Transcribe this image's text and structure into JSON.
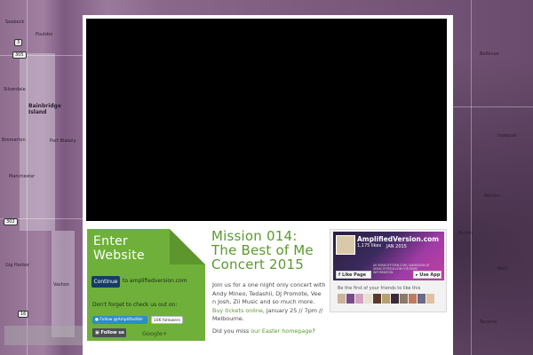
{
  "map": {
    "labels": [
      "Seabeck",
      "Poulsbo",
      "Silverdale",
      "Bremerton",
      "Bainbridge Island",
      "Port Blakely",
      "Manchester",
      "Gig Harbor",
      "Vashon",
      "Burien",
      "Tacoma",
      "Kent",
      "Bellevue",
      "Issaquah",
      "Renton"
    ],
    "shields": [
      "305",
      "16",
      "302",
      "3"
    ]
  },
  "enter_panel": {
    "heading": "Enter Website",
    "continue_label": "Continue",
    "continue_suffix": "to amplifiedversion.com",
    "checkout_text": "Don't forget to check us out on:",
    "twitter_follow": "Follow @AmplifiedVer",
    "twitter_count": "106 followers",
    "follow_us_label": "Follow us",
    "gplus_label": "Google+"
  },
  "event": {
    "title": "Mission 014: The Best of Me Concert 2015",
    "desc_part1": "Join us for a one night only concert with Andy Mineo, Tedashii, DJ Promote, Vee n Josh, Zii Music and so much more. ",
    "desc_link": "Buy tickets online",
    "desc_part2": ", January 25 // 7pm // Melbourne.",
    "miss_part1": "Did you miss ",
    "miss_link": "our Easter homepage",
    "miss_part2": "?"
  },
  "facebook": {
    "page_name": "AmplifiedVersion.com",
    "likes": "1,175 likes",
    "cover_date": "JAN 2015",
    "cover_fine": "AV VERACITYTEEN.COM / ADMISSION AT VERACITYTEEN.COM FOR MORE INFORMATION",
    "like_page_label": "Like Page",
    "use_app_label": "Use App",
    "friends_text": "Be the first of your friends to like this",
    "face_colors": [
      "#c9b39a",
      "#7a4b8a",
      "#d4a0c0",
      "#e8e0d0",
      "#5a3a2a",
      "#b6a070",
      "#3a2a3a",
      "#8a7a6a",
      "#c07a60",
      "#6a6a8a",
      "#e0c0a0"
    ]
  },
  "colors": {
    "green_panel": "#6fb03a",
    "title_green": "#5a9a2e",
    "continue_blue": "#163c66",
    "map_purple": "#7d5a80"
  }
}
